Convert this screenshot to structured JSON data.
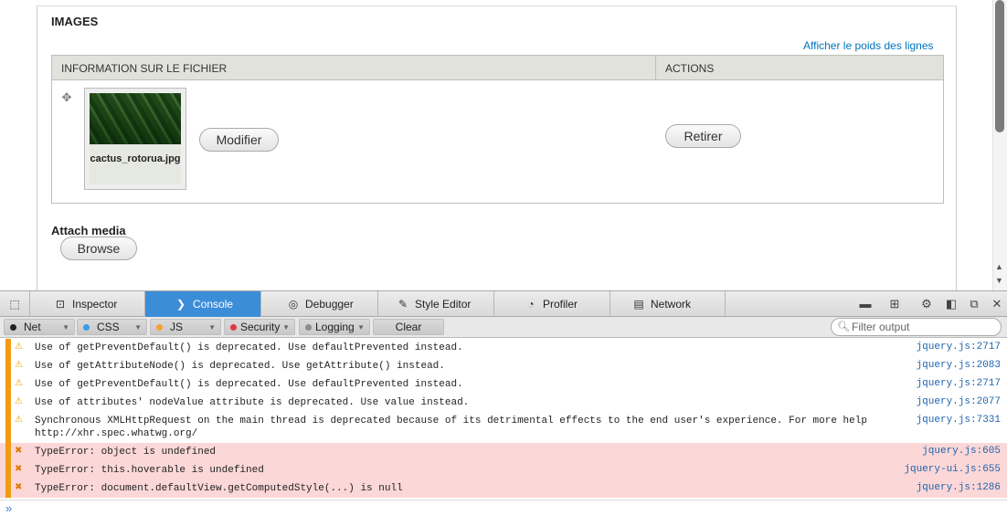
{
  "page": {
    "images_title": "IMAGES",
    "weights_link": "Afficher le poids des lignes",
    "table": {
      "col_info": "INFORMATION SUR LE FICHIER",
      "col_actions": "ACTIONS"
    },
    "file": {
      "caption": "cactus_rotorua.jpg",
      "modify_label": "Modifier",
      "remove_label": "Retirer"
    },
    "attach_label": "Attach media",
    "browse_label": "Browse"
  },
  "devtools": {
    "tabs": [
      {
        "label": "Inspector",
        "icon": "inspector-icon"
      },
      {
        "label": "Console",
        "icon": "console-icon",
        "active": true
      },
      {
        "label": "Debugger",
        "icon": "debugger-icon"
      },
      {
        "label": "Style Editor",
        "icon": "style-editor-icon"
      },
      {
        "label": "Profiler",
        "icon": "profiler-icon"
      },
      {
        "label": "Network",
        "icon": "network-icon"
      }
    ],
    "filters": [
      {
        "label": "Net",
        "color": "#222222"
      },
      {
        "label": "CSS",
        "color": "#3a9ee6"
      },
      {
        "label": "JS",
        "color": "#f7a035"
      },
      {
        "label": "Security",
        "color": "#e0383e"
      },
      {
        "label": "Logging",
        "color": "#8c8c8c"
      }
    ],
    "clear_label": "Clear",
    "filter_placeholder": "Filter output",
    "messages": [
      {
        "level": "warning",
        "text": "Use of getPreventDefault() is deprecated.  Use defaultPrevented instead.",
        "source": "jquery.js:2717"
      },
      {
        "level": "warning",
        "text": "Use of getAttributeNode() is deprecated. Use getAttribute() instead.",
        "source": "jquery.js:2083"
      },
      {
        "level": "warning",
        "text": "Use of getPreventDefault() is deprecated.  Use defaultPrevented instead.",
        "source": "jquery.js:2717"
      },
      {
        "level": "warning",
        "text": "Use of attributes' nodeValue attribute is deprecated. Use value instead.",
        "source": "jquery.js:2077"
      },
      {
        "level": "warning",
        "text": "Synchronous XMLHttpRequest on the main thread is deprecated because of its detrimental effects to the end user's experience. For more help http://xhr.spec.whatwg.org/",
        "source": "jquery.js:7331"
      },
      {
        "level": "error",
        "text": "TypeError: object is undefined",
        "source": "jquery.js:605"
      },
      {
        "level": "error",
        "text": "TypeError: this.hoverable is undefined",
        "source": "jquery-ui.js:655"
      },
      {
        "level": "error",
        "text": "TypeError: document.defaultView.getComputedStyle(...) is null",
        "source": "jquery.js:1286"
      }
    ],
    "prompt_symbol": "»"
  }
}
